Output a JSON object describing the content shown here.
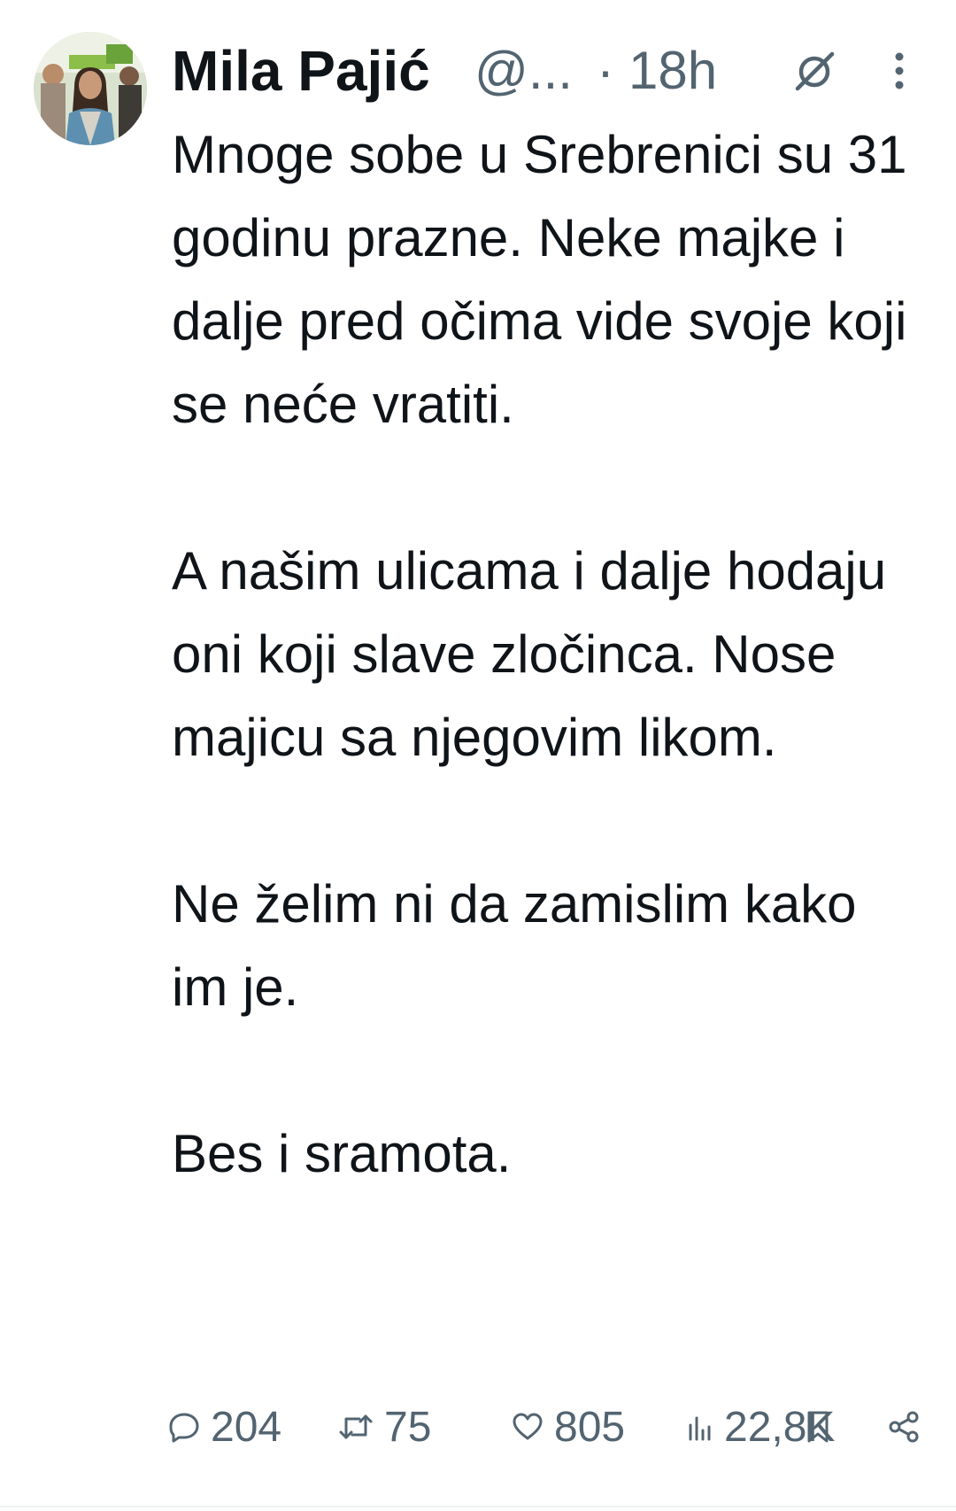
{
  "tweet": {
    "display_name": "Mila Pajić",
    "handle": "@...",
    "separator": "·",
    "time": "18h",
    "paragraphs": [
      "Mnoge sobe u Srebrenici su 31 godinu prazne. Neke majke i dalje pred očima vide svoje koji se neće vratiti.",
      "A našim ulicama i dalje hodaju oni koji slave zločinca. Nose majicu sa njegovim likom.",
      "Ne želim ni da zamislim kako im je.",
      "Bes i sramota."
    ],
    "actions": {
      "replies": "204",
      "retweets": "75",
      "likes": "805",
      "views": "22,8K"
    },
    "icons": {
      "avatar": "profile-photo",
      "grok": "grok-icon",
      "more": "more-vertical-icon",
      "reply": "reply-icon",
      "retweet": "retweet-icon",
      "like": "heart-icon",
      "views": "views-icon",
      "bookmark": "bookmark-icon",
      "share": "share-icon"
    },
    "colors": {
      "text": "#0f1419",
      "secondary": "#536471",
      "background": "#ffffff"
    }
  }
}
